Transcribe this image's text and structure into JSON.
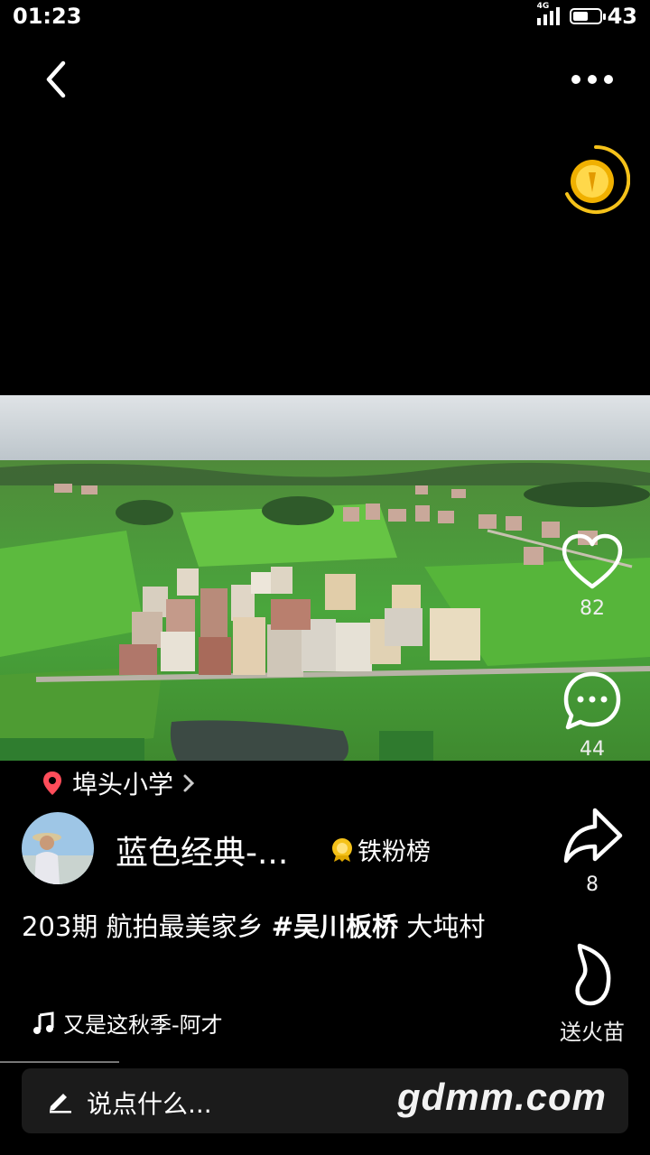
{
  "status_bar": {
    "time": "01:23",
    "network": "4G",
    "battery": "43"
  },
  "icons": {
    "back": "back-arrow-icon",
    "more": "more-dots-icon",
    "coin": "gold-coin-icon",
    "heart": "heart-icon",
    "comment": "comment-icon",
    "share": "share-icon",
    "fire": "fire-icon",
    "location": "location-pin-icon",
    "music": "music-note-icon",
    "pencil": "pencil-icon"
  },
  "colors": {
    "accent_gold": "#f5c21a",
    "pin_red": "#ff4d5a"
  },
  "actions": {
    "like_count": "82",
    "comment_count": "44",
    "share_count": "8",
    "gift_label": "送火苗"
  },
  "post": {
    "location": "埠头小学",
    "author": "蓝色经典-...",
    "fans_board": "铁粉榜",
    "caption_prefix": "203期 航拍最美家乡 ",
    "caption_tag": "#吴川板桥",
    "caption_suffix": "  大坉村",
    "music": "又是这秋季-阿才"
  },
  "comment_bar": {
    "placeholder": "说点什么..."
  },
  "watermark": "gdmm.com"
}
